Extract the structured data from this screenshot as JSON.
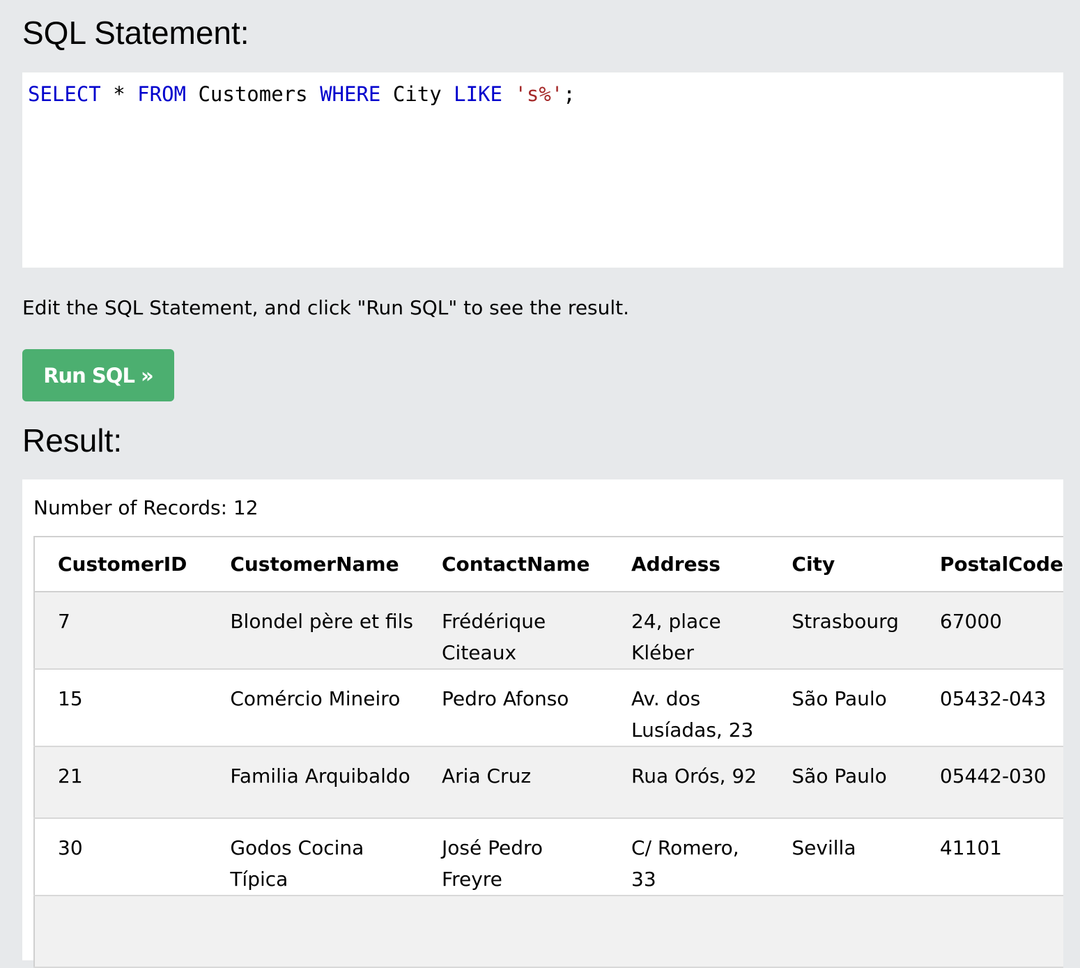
{
  "sql_title": "SQL Statement:",
  "sql": {
    "kw_select": "SELECT",
    "star": " * ",
    "kw_from": "FROM",
    "table": " Customers ",
    "kw_where": "WHERE",
    "column": " City ",
    "kw_like": "LIKE",
    "space": " ",
    "pattern": "'s%'",
    "semicolon": ";"
  },
  "hint": "Edit the SQL Statement, and click \"Run SQL\" to see the result.",
  "run_button": "Run SQL »",
  "result_title": "Result:",
  "records_label": "Number of Records: 12",
  "columns": [
    "CustomerID",
    "CustomerName",
    "ContactName",
    "Address",
    "City",
    "PostalCode"
  ],
  "rows": [
    [
      "7",
      "Blondel père et fils",
      "Frédérique Citeaux",
      "24, place Kléber",
      "Strasbourg",
      "67000"
    ],
    [
      "15",
      "Comércio Mineiro",
      "Pedro Afonso",
      "Av. dos Lusíadas, 23",
      "São Paulo",
      "05432-043"
    ],
    [
      "21",
      "Familia Arquibaldo",
      "Aria Cruz",
      "Rua Orós, 92",
      "São Paulo",
      "05442-030"
    ],
    [
      "30",
      "Godos Cocina Típica",
      "José Pedro Freyre",
      "C/ Romero, 33",
      "Sevilla",
      "41101"
    ]
  ],
  "colors": {
    "keyword": "#0000cd",
    "string": "#a52a2a",
    "button": "#4caf70",
    "page_bg": "#e7e9eb"
  }
}
